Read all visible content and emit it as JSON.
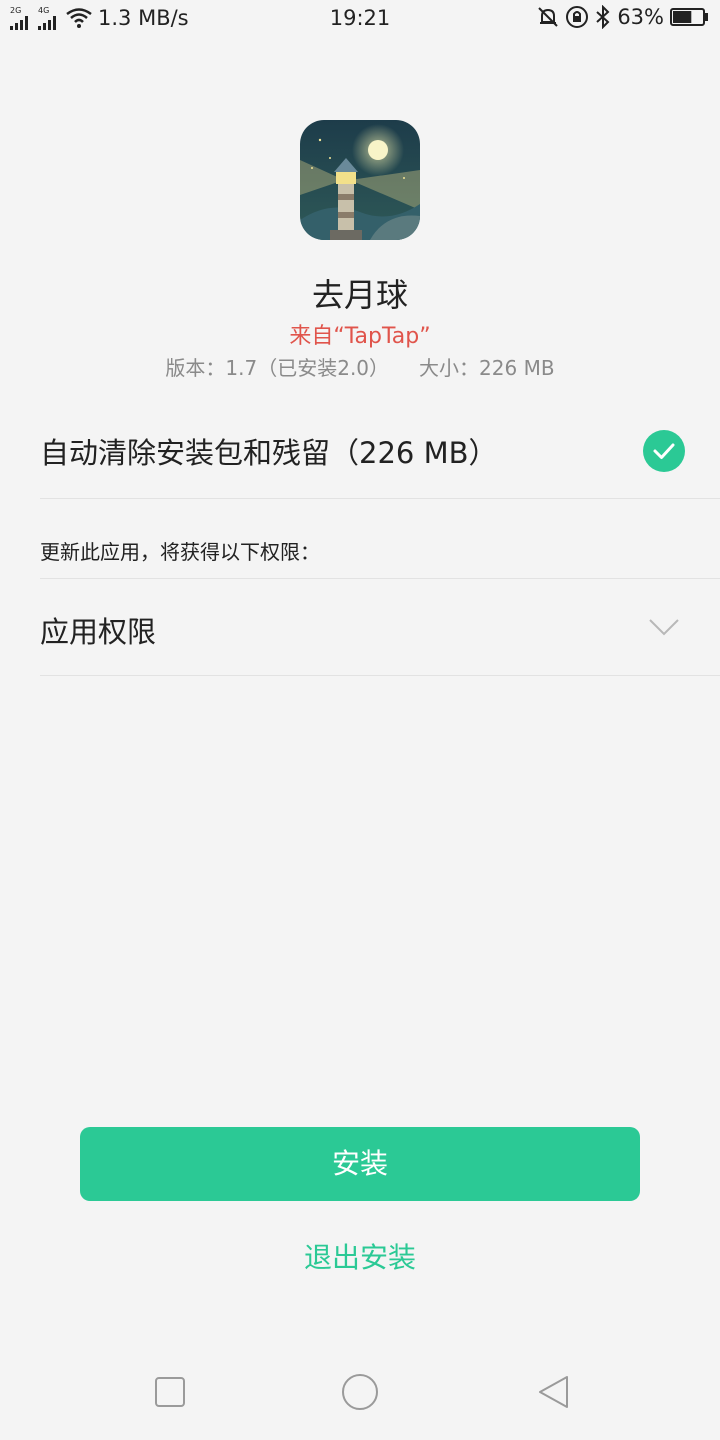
{
  "status_bar": {
    "sim1_label": "2G",
    "sim2_label": "4G",
    "speed": "1.3 MB/s",
    "time": "19:21",
    "battery": "63%",
    "battery_level_fraction": 0.63
  },
  "app": {
    "icon": "lighthouse-app-icon",
    "name": "去月球",
    "source": "来自“TapTap”",
    "version": "版本：1.7（已安装2.0）",
    "size": "大小：226 MB"
  },
  "options": {
    "auto_clean_label": "自动清除安装包和残留（226 MB）",
    "auto_clean_checked": true
  },
  "permissions": {
    "note": "更新此应用，将获得以下权限：",
    "section_label": "应用权限"
  },
  "actions": {
    "install_label": "安装",
    "exit_label": "退出安装"
  },
  "nav": {
    "recent_icon": "square-icon",
    "home_icon": "circle-icon",
    "back_icon": "triangle-back-icon"
  },
  "colors": {
    "accent": "#2bc995",
    "source_red": "#e0544b",
    "background": "#f4f4f4"
  }
}
